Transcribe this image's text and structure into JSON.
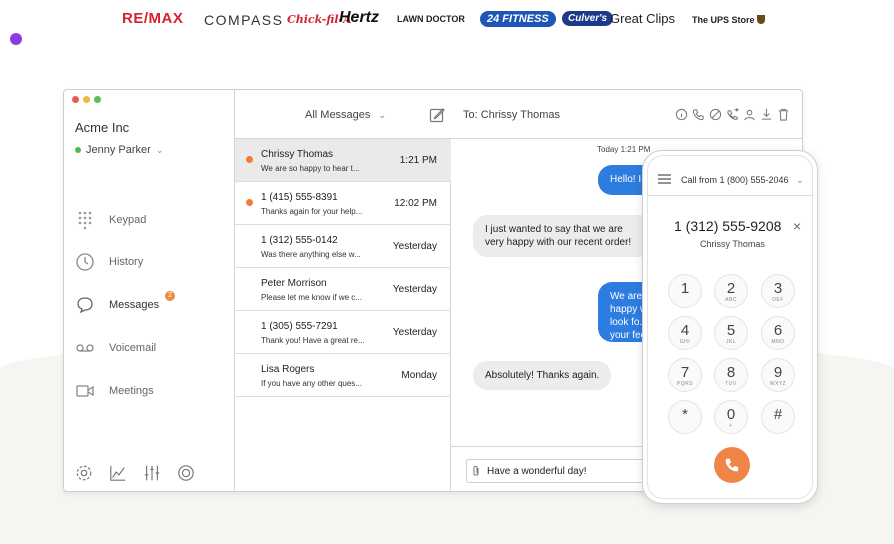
{
  "logos": {
    "remax": "RE/MAX",
    "compass": "COMPASS",
    "chickfila": "Chick-fil-A",
    "hertz": "Hertz",
    "lawndoctor": "LAWN DOCTOR",
    "fitness": "24 FITNESS",
    "culvers": "Culver's",
    "greatclips": "Great Clips",
    "upsstore": "The UPS Store"
  },
  "app": {
    "company": "Acme Inc",
    "user_name": "Jenny Parker",
    "nav": [
      {
        "label": "Keypad",
        "icon": "keypad-icon"
      },
      {
        "label": "History",
        "icon": "clock-icon"
      },
      {
        "label": "Messages",
        "icon": "chat-icon",
        "badge": "2"
      },
      {
        "label": "Voicemail",
        "icon": "voicemail-icon"
      },
      {
        "label": "Meetings",
        "icon": "video-icon"
      }
    ],
    "bottom_icons": [
      "gear-icon",
      "chart-icon",
      "sliders-icon",
      "support-icon"
    ]
  },
  "toolbar": {
    "filter_label": "All Messages",
    "to_label": "To: Chrissy  Thomas",
    "icons": [
      "info-icon",
      "phone-icon",
      "block-icon",
      "phone-forward-icon",
      "contact-icon",
      "download-icon",
      "trash-icon"
    ]
  },
  "conversations": [
    {
      "name": "Chrissy Thomas",
      "preview": "We are so happy to hear t...",
      "time": "1:21 PM",
      "unread": true,
      "selected": true
    },
    {
      "name": "1 (415) 555-8391",
      "preview": "Thanks again for your help...",
      "time": "12:02 PM",
      "unread": true,
      "selected": false
    },
    {
      "name": "1 (312) 555-0142",
      "preview": "Was there anything else w...",
      "time": "Yesterday",
      "unread": false,
      "selected": false
    },
    {
      "name": "Peter Morrison",
      "preview": "Please let me know if we c...",
      "time": "Yesterday",
      "unread": false,
      "selected": false
    },
    {
      "name": "1 (305) 555-7291",
      "preview": "Thank you! Have a great re...",
      "time": "Yesterday",
      "unread": false,
      "selected": false
    },
    {
      "name": "Lisa Rogers",
      "preview": "If you have any other ques...",
      "time": "Monday",
      "unread": false,
      "selected": false
    }
  ],
  "thread": {
    "date_label": "Today 1:21 PM",
    "messages": [
      {
        "dir": "out",
        "text": "Hello! I"
      },
      {
        "dir": "in",
        "text": "I just wanted to say that we are very happy with our recent order!"
      },
      {
        "dir": "out",
        "text": "We are happy w... look fo... your fee..."
      },
      {
        "dir": "in",
        "text": "Absolutely! Thanks again."
      }
    ],
    "composer_value": "Have a wonderful day!"
  },
  "phone": {
    "call_from": "Call from 1 (800) 555-2046",
    "dialed_number": "1 (312) 555-9208",
    "dialed_name": "Chrissy  Thomas",
    "clear_symbol": "×",
    "keys": [
      {
        "digit": "1",
        "letters": ""
      },
      {
        "digit": "2",
        "letters": "ABC"
      },
      {
        "digit": "3",
        "letters": "DEF"
      },
      {
        "digit": "4",
        "letters": "GHI"
      },
      {
        "digit": "5",
        "letters": "JKL"
      },
      {
        "digit": "6",
        "letters": "MNO"
      },
      {
        "digit": "7",
        "letters": "PQRS"
      },
      {
        "digit": "8",
        "letters": "TUV"
      },
      {
        "digit": "9",
        "letters": "WXYZ"
      },
      {
        "digit": "*",
        "letters": ""
      },
      {
        "digit": "0",
        "letters": "+"
      },
      {
        "digit": "#",
        "letters": ""
      }
    ]
  },
  "colors": {
    "accent_blue": "#2d7de0",
    "unread_orange": "#ef7d36",
    "call_orange": "#ef8547",
    "online_green": "#4cbb4f",
    "purple_dot": "#8a3be3"
  }
}
